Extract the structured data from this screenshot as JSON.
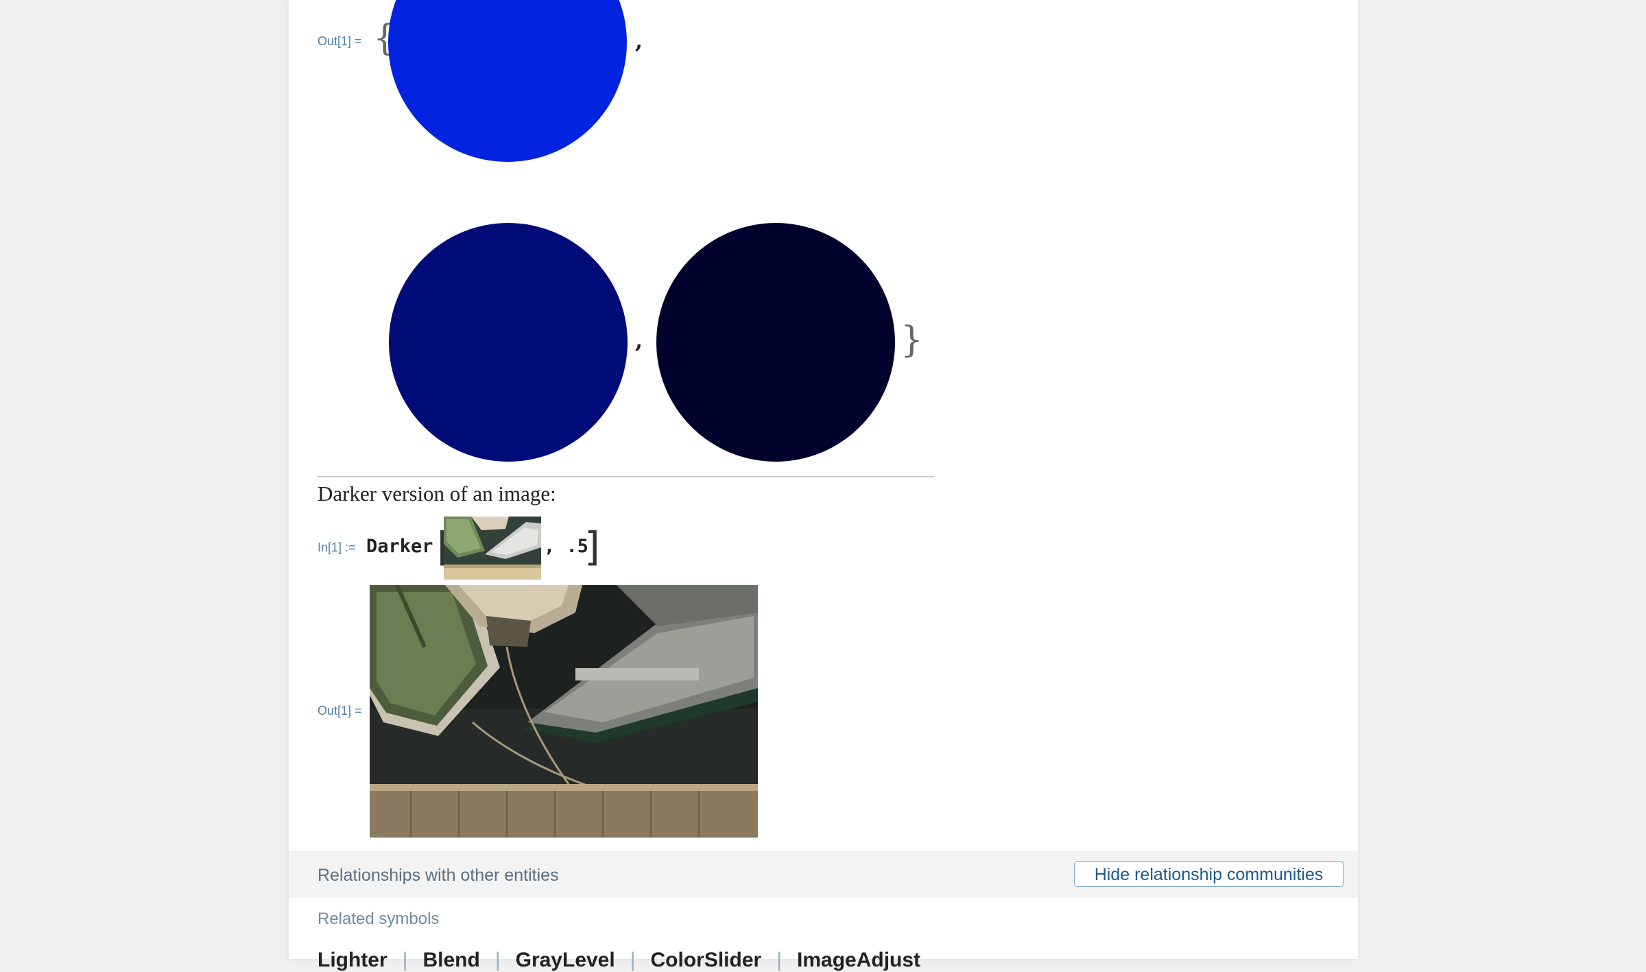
{
  "example1": {
    "out_label": "Out[1] =",
    "open_brace": "{",
    "close_brace": "}",
    "separator": ",",
    "circles": [
      {
        "name": "bright-blue-disk",
        "color": "#0223e0"
      },
      {
        "name": "dark-blue-disk",
        "color": "#010c78"
      },
      {
        "name": "very-dark-blue-disk",
        "color": "#00022b"
      }
    ]
  },
  "example2": {
    "caption": "Darker version of an image:",
    "in_label": "In[1] :=",
    "function_name": "Darker",
    "open_bracket": "[",
    "close_bracket": "]",
    "argument": ", .5",
    "out_label": "Out[1] ="
  },
  "relationships": {
    "title": "Relationships with other entities",
    "toggle_button": "Hide relationship communities",
    "related_label": "Related symbols",
    "symbols": [
      "Lighter",
      "Blend",
      "GrayLevel",
      "ColorSlider",
      "ImageAdjust"
    ],
    "separator": "|"
  }
}
